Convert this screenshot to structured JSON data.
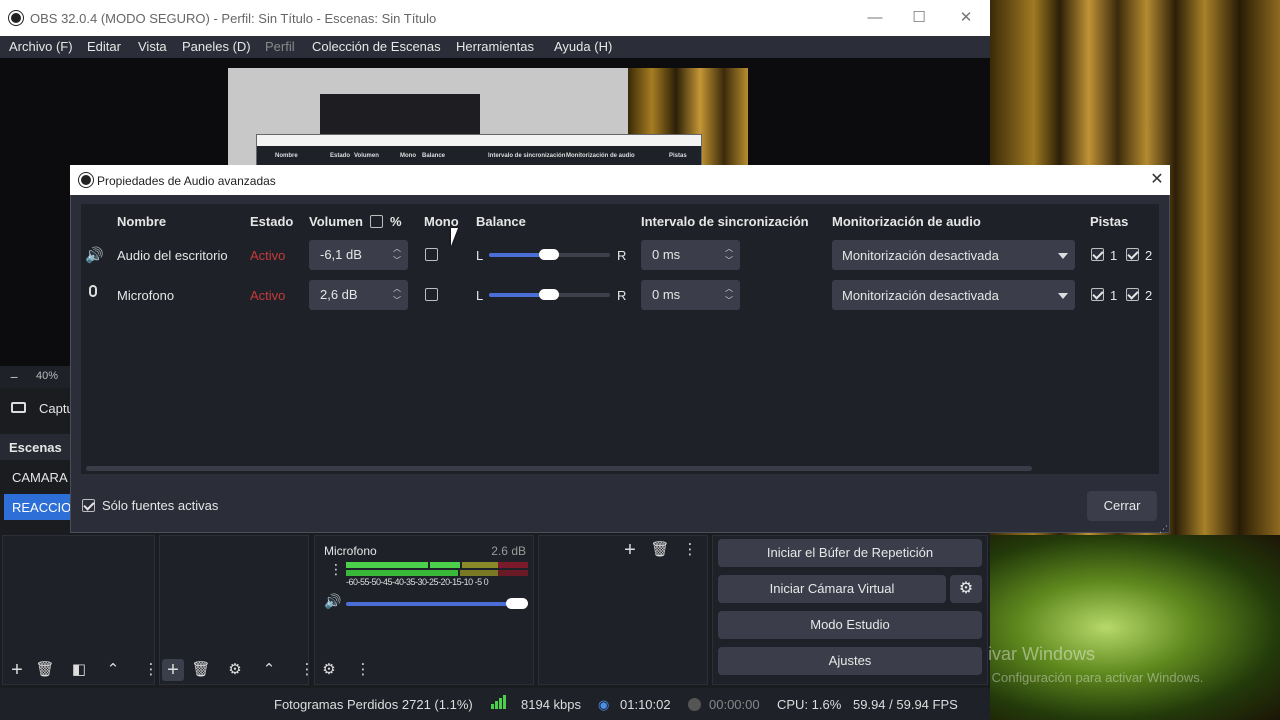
{
  "window": {
    "title": "OBS 32.0.4 (MODO SEGURO) - Perfil: Sin Título - Escenas: Sin Título",
    "controls": {
      "minimize": "—",
      "maximize": "☐",
      "close": "✕"
    }
  },
  "menu": [
    "Archivo (F)",
    "Editar",
    "Vista",
    "Paneles (D)",
    "Perfil",
    "Colección de Escenas",
    "Herramientas",
    "Ayuda (H)"
  ],
  "preview_dialog_headers": [
    "Nombre",
    "Estado",
    "Volumen",
    "Mono",
    "Balance",
    "Intervalo de sincronización",
    "Monitorización de audio",
    "Pistas"
  ],
  "left_dock": {
    "zoom": "40%",
    "zoom_minus": "−",
    "source_label": "Captu",
    "scenes_title": "Escenas",
    "scenes": [
      "CAMARA",
      "REACCION"
    ]
  },
  "dialog": {
    "title": "Propiedades de Audio avanzadas",
    "close_icon": "✕",
    "headers": {
      "name": "Nombre",
      "state": "Estado",
      "volume": "Volumen",
      "percent": "%",
      "mono": "Mono",
      "balance": "Balance",
      "sync": "Intervalo de sincronización",
      "monitoring": "Monitorización de audio",
      "tracks": "Pistas"
    },
    "rows": [
      {
        "icon": "speaker-icon",
        "name": "Audio del escritorio",
        "state": "Activo",
        "volume": "-6,1 dB",
        "mono": false,
        "balance_left": "L",
        "balance_right": "R",
        "balance": 0.5,
        "sync": "0 ms",
        "monitoring": "Monitorización desactivada",
        "tracks": [
          "1",
          "2"
        ]
      },
      {
        "icon": "microphone-icon",
        "name": "Microfono",
        "state": "Activo",
        "volume": "2,6 dB",
        "mono": false,
        "balance_left": "L",
        "balance_right": "R",
        "balance": 0.5,
        "sync": "0 ms",
        "monitoring": "Monitorización desactivada",
        "tracks": [
          "1",
          "2"
        ]
      }
    ],
    "only_active_label": "Sólo fuentes activas",
    "only_active_checked": true,
    "close_button": "Cerrar"
  },
  "mixer": {
    "source": "Microfono",
    "level": "2.6 dB",
    "ticks": "-60-55-50-45-40-35-30-25-20-15-10 -5  0",
    "volume_fraction": 0.93
  },
  "controls": {
    "buttons": [
      "Iniciar el Búfer de Repetición",
      "Iniciar Cámara Virtual",
      "Modo Estudio",
      "Ajustes"
    ]
  },
  "statusbar": {
    "dropped_frames": "Fotogramas Perdidos 2721 (1.1%)",
    "bitrate": "8194 kbps",
    "stream_time": "01:10:02",
    "record_time": "00:00:00",
    "cpu": "CPU: 1.6%",
    "fps": "59.94 / 59.94 FPS"
  },
  "watermark": {
    "title": "Activar Windows",
    "subtitle": "Ve a Configuración para activar Windows."
  },
  "colors": {
    "accent": "#2d6fd6",
    "active_state": "#c43a3a",
    "panel": "#1f2128",
    "dialog": "#2b2e38"
  }
}
